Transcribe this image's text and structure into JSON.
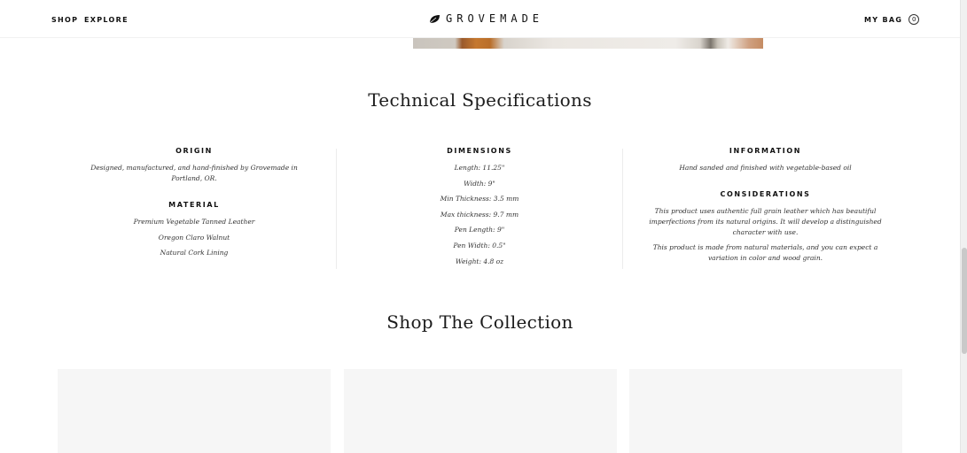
{
  "header": {
    "nav": {
      "shop": "SHOP",
      "explore": "EXPLORE"
    },
    "logo": {
      "text": "GROVEMADE",
      "icon": "leaf-logo-icon"
    },
    "bag": {
      "label": "MY BAG",
      "count": "0"
    }
  },
  "specs": {
    "title": "Technical Specifications",
    "origin": {
      "heading": "ORIGIN",
      "text": "Designed, manufactured, and hand-finished by Grovemade in Portland, OR."
    },
    "material": {
      "heading": "MATERIAL",
      "items": [
        "Premium Vegetable Tanned Leather",
        "Oregon Claro Walnut",
        "Natural Cork Lining"
      ]
    },
    "dimensions": {
      "heading": "DIMENSIONS",
      "items": [
        "Length: 11.25\"",
        "Width: 9\"",
        "Min Thickness: 3.5 mm",
        "Max thickness: 9.7 mm",
        "Pen Length: 9\"",
        "Pen Width: 0.5\"",
        "Weight: 4.8 oz"
      ]
    },
    "information": {
      "heading": "INFORMATION",
      "text": "Hand sanded and finished with vegetable-based oil"
    },
    "considerations": {
      "heading": "CONSIDERATIONS",
      "text1": "This product uses authentic full grain leather which has beautiful imperfections from its natural origins. It will develop a distinguished character with use.",
      "text2": "This product is made from natural materials, and you can expect a variation in color and wood grain."
    }
  },
  "collection": {
    "title": "Shop The Collection"
  },
  "colors": {
    "text": "#222222",
    "card_bg": "#f6f6f6",
    "leather_accent": "#c5782f"
  }
}
